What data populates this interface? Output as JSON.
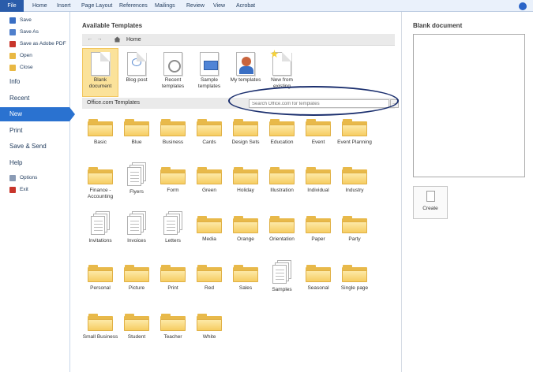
{
  "ribbon": {
    "tabs": [
      "File",
      "Home",
      "Insert",
      "Page Layout",
      "References",
      "Mailings",
      "Review",
      "View",
      "Acrobat"
    ]
  },
  "nav": {
    "save": "Save",
    "save_as": "Save As",
    "save_as_pdf": "Save as Adobe PDF",
    "open": "Open",
    "close": "Close",
    "info": "Info",
    "recent": "Recent",
    "new": "New",
    "print": "Print",
    "save_send": "Save & Send",
    "help": "Help",
    "options": "Options",
    "exit": "Exit"
  },
  "main": {
    "available_title": "Available Templates",
    "breadcrumb_home": "Home",
    "templates": [
      {
        "label": "Blank document",
        "icon": "blank-document-icon",
        "selected": true
      },
      {
        "label": "Blog post",
        "icon": "blog-post-icon"
      },
      {
        "label": "Recent templates",
        "icon": "recent-templates-icon"
      },
      {
        "label": "Sample templates",
        "icon": "sample-templates-icon"
      },
      {
        "label": "My templates",
        "icon": "my-templates-icon"
      },
      {
        "label": "New from existing",
        "icon": "new-from-existing-icon"
      }
    ],
    "office_title": "Office.com Templates",
    "search_placeholder": "Search Office.com for templates",
    "search_go": "→",
    "folders": [
      "Basic",
      "Blue",
      "Business",
      "Cards",
      "Design Sets",
      "Education",
      "Event",
      "Event Planning",
      "Finance - Accounting",
      "Flyers",
      "Form",
      "Green",
      "Holiday",
      "Illustration",
      "Individual",
      "Industry",
      "Invitations",
      "Invoices",
      "Letters",
      "Media",
      "Orange",
      "Orientation",
      "Paper",
      "Party",
      "Personal",
      "Picture",
      "Print",
      "Red",
      "Sales",
      "Samples",
      "Seasonal",
      "Single page",
      "Small Business",
      "Student",
      "Teacher",
      "White"
    ],
    "doc_style_folders": [
      "Flyers",
      "Invitations",
      "Invoices",
      "Letters",
      "Samples"
    ]
  },
  "preview": {
    "title": "Blank document",
    "create_label": "Create"
  },
  "colors": {
    "file_tab": "#2a5caa",
    "nav_selected": "#2a72d0",
    "template_selected": "#fbe29a",
    "folder": "#f6cd62",
    "highlight_ellipse": "#1b2f6e"
  }
}
